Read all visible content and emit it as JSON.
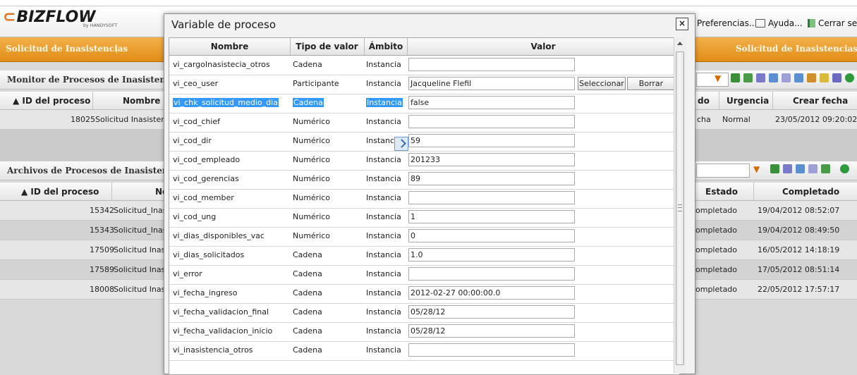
{
  "app": {
    "logo": "BIZFLOW",
    "logo_sub": "by HANDYSOFT",
    "header_links": [
      "Preferencias...",
      "Ayuda...",
      "Cerrar sesi"
    ],
    "tab_left": "Solicitud de Inasistencias",
    "tab_right": "Solicitud de Inasistencias"
  },
  "monitor": {
    "title": "Monitor de Procesos de Inasistencias",
    "columns": [
      "ID del proceso",
      "Nombre de",
      "do",
      "Urgencia",
      "Crear fecha"
    ],
    "rows": [
      {
        "id": "18025",
        "name": "Solicitud Inasistencia",
        "state": "cha",
        "urgency": "Normal",
        "date": "23/05/2012 09:20:02"
      }
    ]
  },
  "archive": {
    "title": "Archivos de Procesos de Inasistencias",
    "columns": [
      "ID del proceso",
      "No",
      "Estado",
      "Completado"
    ],
    "rows": [
      {
        "id": "15342",
        "name": "Solicitud_Inasis",
        "state": "ompletado",
        "date": "19/04/2012 08:52:07"
      },
      {
        "id": "15343",
        "name": "Solicitud_Inasis",
        "state": "ompletado",
        "date": "19/04/2012 08:49:50"
      },
      {
        "id": "17509",
        "name": "Solicitud Inasis",
        "state": "ompletado",
        "date": "16/05/2012 14:18:19"
      },
      {
        "id": "17589",
        "name": "Solicitud Inasis",
        "state": "ompletado",
        "date": "17/05/2012 08:51:14"
      },
      {
        "id": "18008",
        "name": "Solicitud Inasis",
        "state": "ompletado",
        "date": "22/05/2012 17:57:17"
      }
    ]
  },
  "dialog": {
    "title": "Variable de proceso",
    "close": "×",
    "columns": {
      "name": "Nombre",
      "type": "Tipo de valor",
      "scope": "Ámbito",
      "value": "Valor"
    },
    "select_label": "Seleccionar",
    "clear_label": "Borrar",
    "rows": [
      {
        "name": "vi_cargoInasistecia_otros",
        "type": "Cadena",
        "scope": "Instancia",
        "value": ""
      },
      {
        "name": "vi_ceo_user",
        "type": "Participante",
        "scope": "Instancia",
        "value": "Jacqueline Flefil"
      },
      {
        "name": "vi_chk_solicitud_medio_dia",
        "type": "Cadena",
        "scope": "Instancia",
        "value": "false"
      },
      {
        "name": "vi_cod_chief",
        "type": "Numérico",
        "scope": "Instancia",
        "value": ""
      },
      {
        "name": "vi_cod_dir",
        "type": "Numérico",
        "scope": "Instancia",
        "value": "59"
      },
      {
        "name": "vi_cod_empleado",
        "type": "Numérico",
        "scope": "Instancia",
        "value": "201233"
      },
      {
        "name": "vi_cod_gerencias",
        "type": "Numérico",
        "scope": "Instancia",
        "value": "89"
      },
      {
        "name": "vi_cod_member",
        "type": "Numérico",
        "scope": "Instancia",
        "value": ""
      },
      {
        "name": "vi_cod_ung",
        "type": "Numérico",
        "scope": "Instancia",
        "value": "1"
      },
      {
        "name": "vi_dias_disponibles_vac",
        "type": "Numérico",
        "scope": "Instancia",
        "value": "0"
      },
      {
        "name": "vi_dias_solicitados",
        "type": "Cadena",
        "scope": "Instancia",
        "value": "1.0"
      },
      {
        "name": "vi_error",
        "type": "Cadena",
        "scope": "Instancia",
        "value": ""
      },
      {
        "name": "vi_fecha_ingreso",
        "type": "Cadena",
        "scope": "Instancia",
        "value": "2012-02-27 00:00:00.0"
      },
      {
        "name": "vi_fecha_validacion_final",
        "type": "Cadena",
        "scope": "Instancia",
        "value": "05/28/12"
      },
      {
        "name": "vi_fecha_validacion_inicio",
        "type": "Cadena",
        "scope": "Instancia",
        "value": "05/28/12"
      },
      {
        "name": "vi_inasistencia_otros",
        "type": "Cadena",
        "scope": "Instancia",
        "value": ""
      }
    ]
  },
  "colors": {
    "accent_orange": "#e08d16",
    "selection_blue": "#3399ff"
  }
}
